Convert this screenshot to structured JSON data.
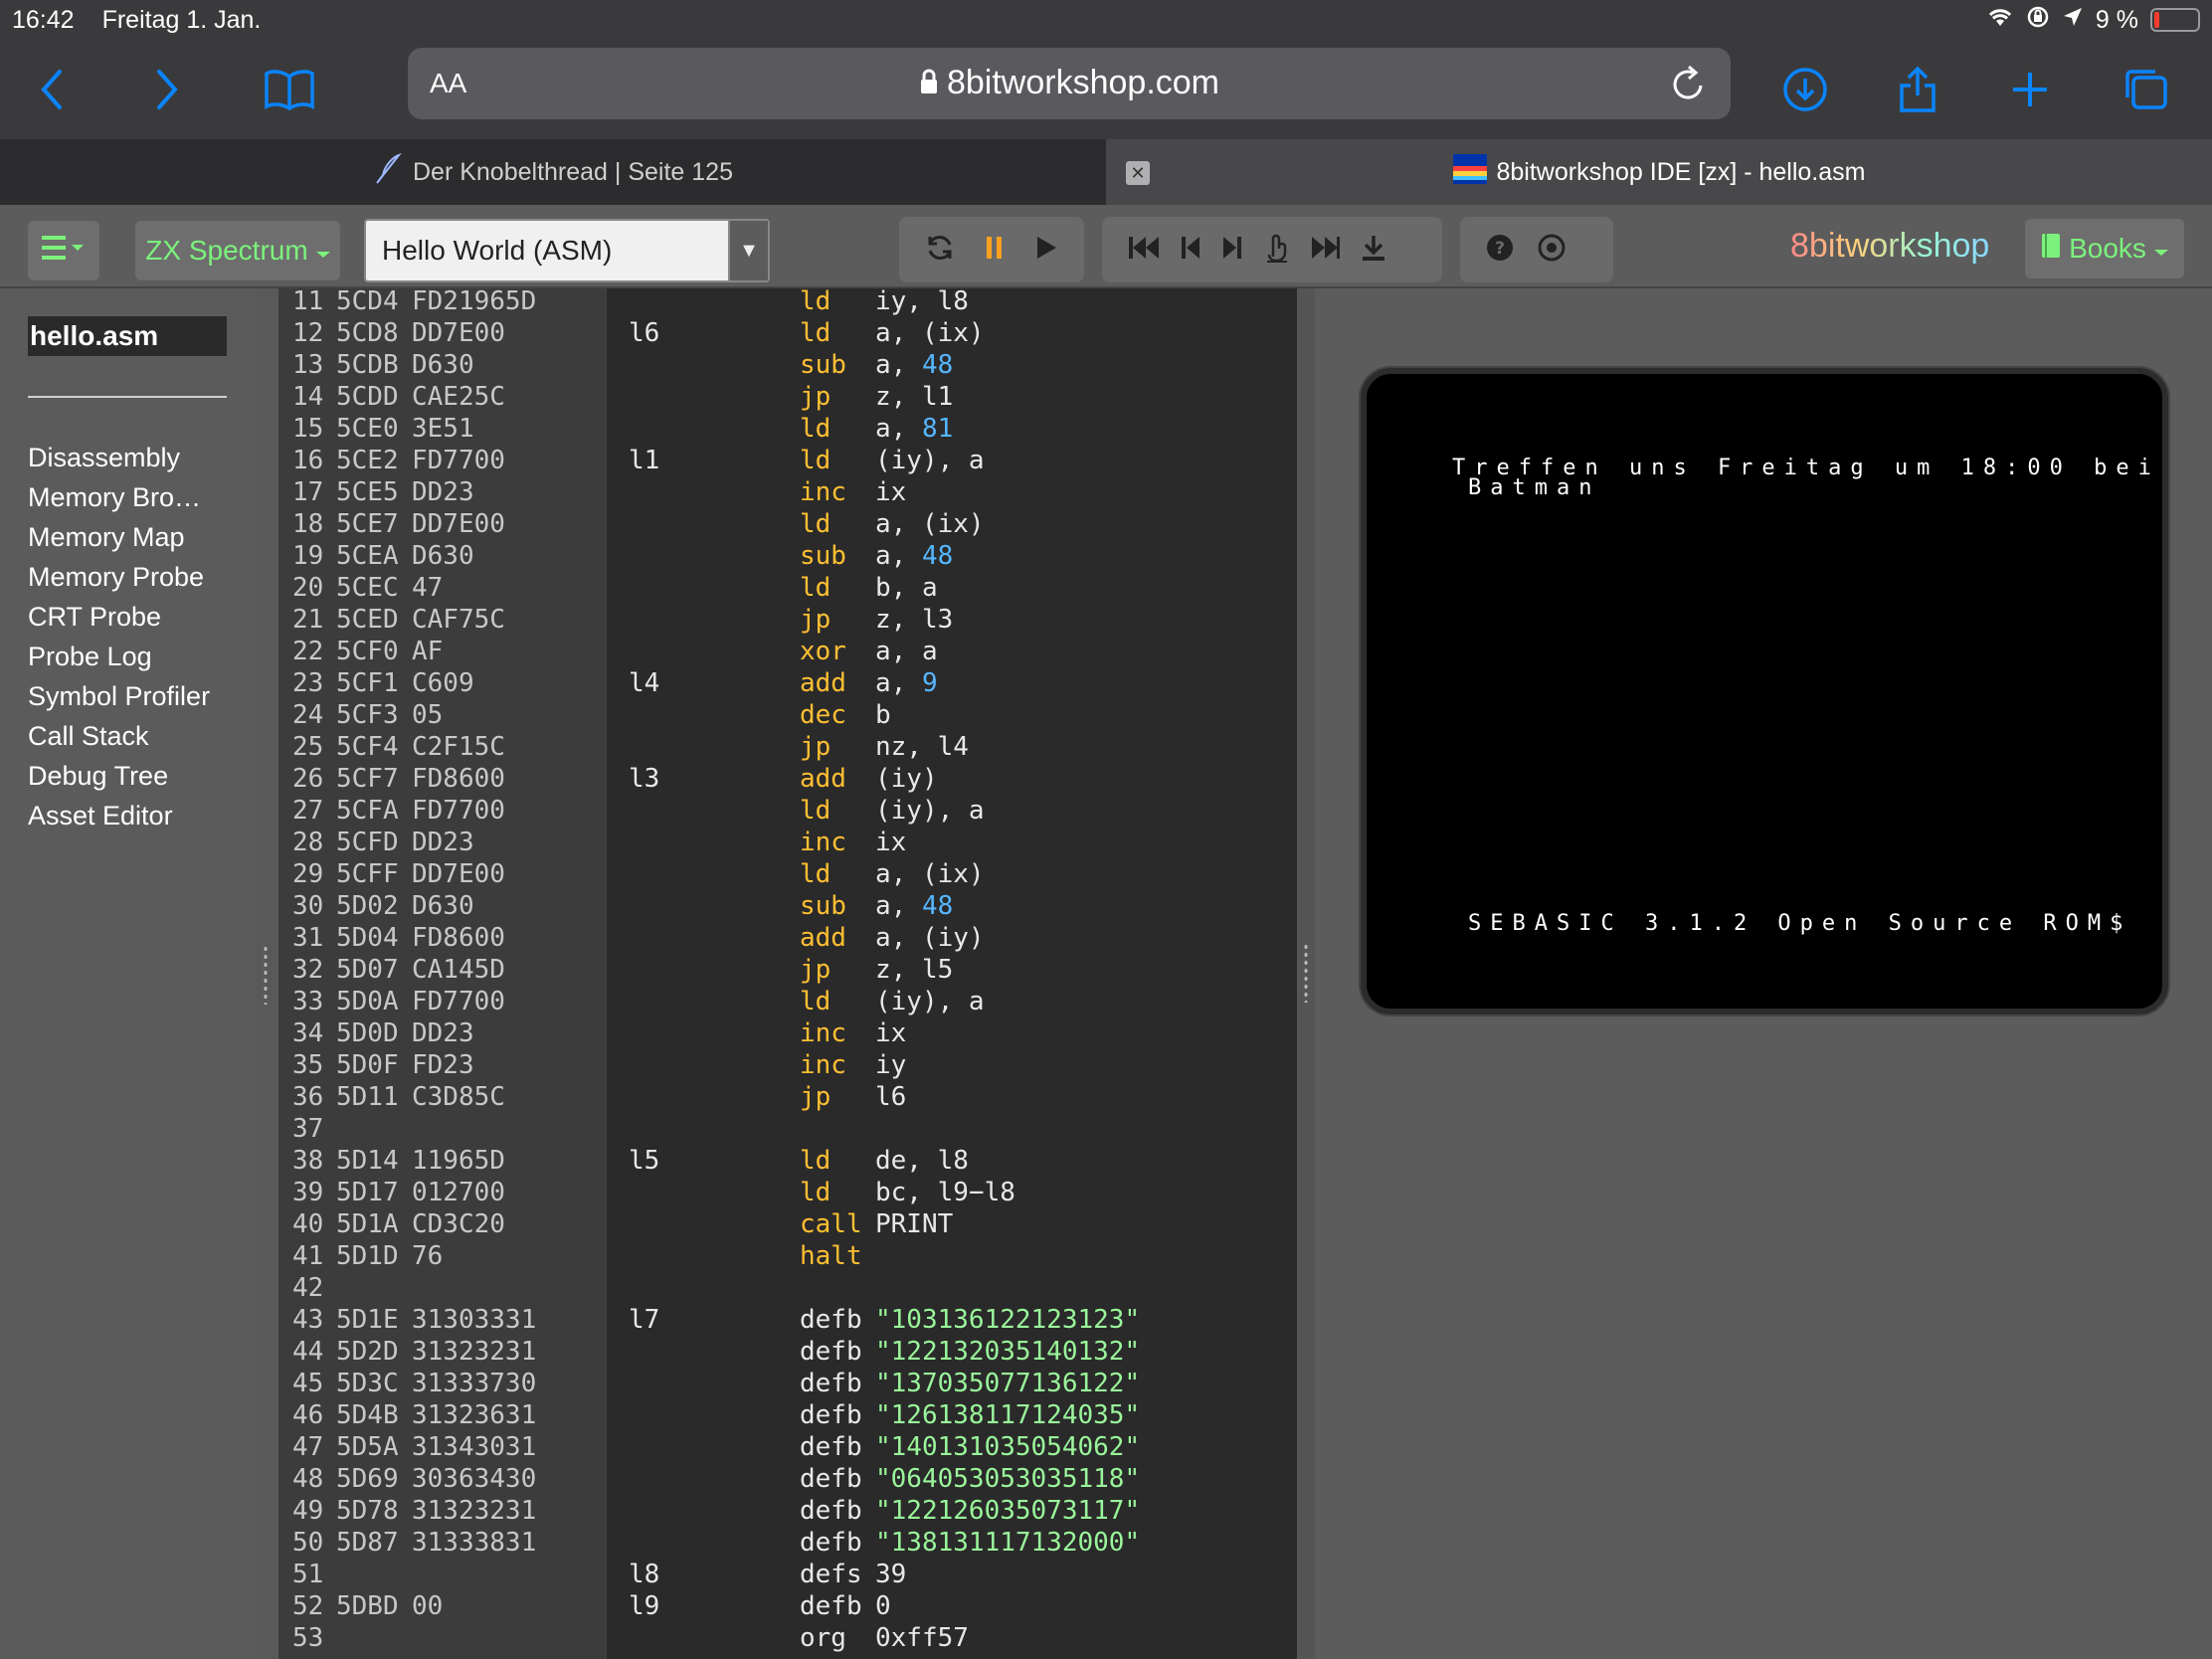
{
  "status": {
    "time": "16:42",
    "date": "Freitag 1. Jan.",
    "battery": "9 %"
  },
  "browser": {
    "aa": "AA",
    "url": "8bitworkshop.com"
  },
  "tabs": [
    {
      "title": "Der Knobelthread | Seite 125"
    },
    {
      "title": "8bitworkshop IDE [zx] - hello.asm"
    }
  ],
  "ide": {
    "platform": "ZX Spectrum",
    "preset": "Hello World (ASM)",
    "brand": "8bitworkshop",
    "books": "Books"
  },
  "sidebar": {
    "file": "hello.asm",
    "items": [
      "Disassembly",
      "Memory Bro…",
      "Memory Map",
      "Memory Probe",
      "CRT Probe",
      "Probe Log",
      "Symbol Profiler",
      "Call Stack",
      "Debug Tree",
      "Asset Editor"
    ]
  },
  "emulator": {
    "line1": "Treffen uns Freitag um 18:00 bei",
    "line2": "Batman",
    "bottom": "SEBASIC 3.1.2 Open Source ROM$"
  },
  "code": [
    {
      "n": "11",
      "a": "5CD4",
      "b": "FD21965D",
      "l": "",
      "op": "ld",
      "arg": "iy, l8",
      "k": "i"
    },
    {
      "n": "12",
      "a": "5CD8",
      "b": "DD7E00",
      "l": "l6",
      "op": "ld",
      "arg": "a, (ix)",
      "k": "i"
    },
    {
      "n": "13",
      "a": "5CDB",
      "b": "D630",
      "l": "",
      "op": "sub",
      "arg": "a, ",
      "num": "48",
      "k": "i"
    },
    {
      "n": "14",
      "a": "5CDD",
      "b": "CAE25C",
      "l": "",
      "op": "jp",
      "arg": "z, l1",
      "k": "i"
    },
    {
      "n": "15",
      "a": "5CE0",
      "b": "3E51",
      "l": "",
      "op": "ld",
      "arg": "a, ",
      "num": "81",
      "k": "i"
    },
    {
      "n": "16",
      "a": "5CE2",
      "b": "FD7700",
      "l": "l1",
      "op": "ld",
      "arg": "(iy), a",
      "k": "i"
    },
    {
      "n": "17",
      "a": "5CE5",
      "b": "DD23",
      "l": "",
      "op": "inc",
      "arg": "ix",
      "k": "i"
    },
    {
      "n": "18",
      "a": "5CE7",
      "b": "DD7E00",
      "l": "",
      "op": "ld",
      "arg": "a, (ix)",
      "k": "i"
    },
    {
      "n": "19",
      "a": "5CEA",
      "b": "D630",
      "l": "",
      "op": "sub",
      "arg": "a, ",
      "num": "48",
      "k": "i"
    },
    {
      "n": "20",
      "a": "5CEC",
      "b": "47",
      "l": "",
      "op": "ld",
      "arg": "b, a",
      "k": "i"
    },
    {
      "n": "21",
      "a": "5CED",
      "b": "CAF75C",
      "l": "",
      "op": "jp",
      "arg": "z, l3",
      "k": "i"
    },
    {
      "n": "22",
      "a": "5CF0",
      "b": "AF",
      "l": "",
      "op": "xor",
      "arg": "a, a",
      "k": "i"
    },
    {
      "n": "23",
      "a": "5CF1",
      "b": "C609",
      "l": "l4",
      "op": "add",
      "arg": "a, ",
      "num": "9",
      "k": "i"
    },
    {
      "n": "24",
      "a": "5CF3",
      "b": "05",
      "l": "",
      "op": "dec",
      "arg": "b",
      "k": "i"
    },
    {
      "n": "25",
      "a": "5CF4",
      "b": "C2F15C",
      "l": "",
      "op": "jp",
      "arg": "nz, l4",
      "k": "i"
    },
    {
      "n": "26",
      "a": "5CF7",
      "b": "FD8600",
      "l": "l3",
      "op": "add",
      "arg": "(iy)",
      "k": "i"
    },
    {
      "n": "27",
      "a": "5CFA",
      "b": "FD7700",
      "l": "",
      "op": "ld",
      "arg": "(iy), a",
      "k": "i"
    },
    {
      "n": "28",
      "a": "5CFD",
      "b": "DD23",
      "l": "",
      "op": "inc",
      "arg": "ix",
      "k": "i"
    },
    {
      "n": "29",
      "a": "5CFF",
      "b": "DD7E00",
      "l": "",
      "op": "ld",
      "arg": "a, (ix)",
      "k": "i"
    },
    {
      "n": "30",
      "a": "5D02",
      "b": "D630",
      "l": "",
      "op": "sub",
      "arg": "a, ",
      "num": "48",
      "k": "i"
    },
    {
      "n": "31",
      "a": "5D04",
      "b": "FD8600",
      "l": "",
      "op": "add",
      "arg": "a, (iy)",
      "k": "i"
    },
    {
      "n": "32",
      "a": "5D07",
      "b": "CA145D",
      "l": "",
      "op": "jp",
      "arg": "z, l5",
      "k": "i"
    },
    {
      "n": "33",
      "a": "5D0A",
      "b": "FD7700",
      "l": "",
      "op": "ld",
      "arg": "(iy), a",
      "k": "i"
    },
    {
      "n": "34",
      "a": "5D0D",
      "b": "DD23",
      "l": "",
      "op": "inc",
      "arg": "ix",
      "k": "i"
    },
    {
      "n": "35",
      "a": "5D0F",
      "b": "FD23",
      "l": "",
      "op": "inc",
      "arg": "iy",
      "k": "i"
    },
    {
      "n": "36",
      "a": "5D11",
      "b": "C3D85C",
      "l": "",
      "op": "jp",
      "arg": "l6",
      "k": "i"
    },
    {
      "n": "37",
      "a": "",
      "b": "",
      "l": "",
      "op": "",
      "arg": "",
      "k": "i"
    },
    {
      "n": "38",
      "a": "5D14",
      "b": "11965D",
      "l": "l5",
      "op": "ld",
      "arg": "de, l8",
      "k": "i"
    },
    {
      "n": "39",
      "a": "5D17",
      "b": "012700",
      "l": "",
      "op": "ld",
      "arg": "bc, l9−l8",
      "k": "i"
    },
    {
      "n": "40",
      "a": "5D1A",
      "b": "CD3C20",
      "l": "",
      "op": "call",
      "arg": "PRINT",
      "k": "i"
    },
    {
      "n": "41",
      "a": "5D1D",
      "b": "76",
      "l": "",
      "op": "halt",
      "arg": "",
      "k": "i"
    },
    {
      "n": "42",
      "a": "",
      "b": "",
      "l": "",
      "op": "",
      "arg": "",
      "k": "i"
    },
    {
      "n": "43",
      "a": "5D1E",
      "b": "31303331",
      "l": "l7",
      "op": "defb",
      "str": "\"103136122123123\"",
      "k": "d"
    },
    {
      "n": "44",
      "a": "5D2D",
      "b": "31323231",
      "l": "",
      "op": "defb",
      "str": "\"122132035140132\"",
      "k": "d"
    },
    {
      "n": "45",
      "a": "5D3C",
      "b": "31333730",
      "l": "",
      "op": "defb",
      "str": "\"137035077136122\"",
      "k": "d"
    },
    {
      "n": "46",
      "a": "5D4B",
      "b": "31323631",
      "l": "",
      "op": "defb",
      "str": "\"126138117124035\"",
      "k": "d"
    },
    {
      "n": "47",
      "a": "5D5A",
      "b": "31343031",
      "l": "",
      "op": "defb",
      "str": "\"140131035054062\"",
      "k": "d"
    },
    {
      "n": "48",
      "a": "5D69",
      "b": "30363430",
      "l": "",
      "op": "defb",
      "str": "\"064053053035118\"",
      "k": "d"
    },
    {
      "n": "49",
      "a": "5D78",
      "b": "31323231",
      "l": "",
      "op": "defb",
      "str": "\"122126035073117\"",
      "k": "d"
    },
    {
      "n": "50",
      "a": "5D87",
      "b": "31333831",
      "l": "",
      "op": "defb",
      "str": "\"138131117132000\"",
      "k": "d"
    },
    {
      "n": "51",
      "a": "",
      "b": "",
      "l": "l8",
      "op": "defs",
      "arg": "39",
      "k": "d"
    },
    {
      "n": "52",
      "a": "5DBD",
      "b": "00",
      "l": "l9",
      "op": "defb",
      "arg": "0",
      "k": "d"
    },
    {
      "n": "53",
      "a": "",
      "b": "",
      "l": "",
      "op": "org",
      "arg": "0xff57",
      "k": "d"
    }
  ],
  "colors": {
    "accent": "#0a84ff",
    "opcode": "#ffbf33",
    "number": "#56b6ff",
    "string": "#9af59a",
    "green": "#7cf27c"
  }
}
